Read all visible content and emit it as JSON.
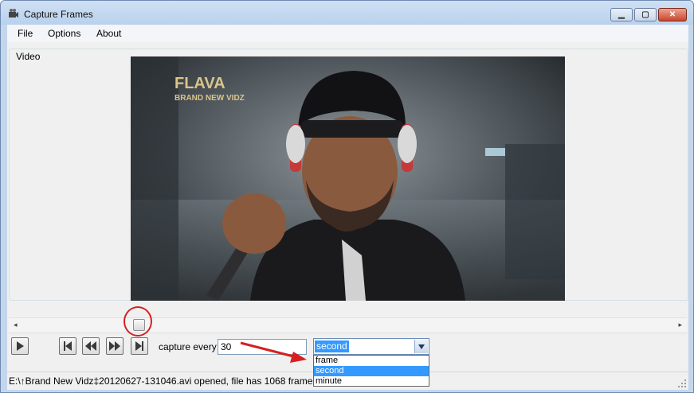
{
  "window": {
    "title": "Capture Frames",
    "min_label": "▁",
    "max_label": "▢",
    "close_label": "✕"
  },
  "menu": {
    "items": [
      "File",
      "Options",
      "About"
    ]
  },
  "video_group": {
    "label": "Video",
    "overlay_title": "FLAVA",
    "overlay_subtitle": "BRAND NEW VIDZ"
  },
  "playback": {
    "buttons": [
      "play-icon",
      "skip-to-start-icon",
      "rewind-icon",
      "fast-forward-icon",
      "skip-to-end-icon"
    ]
  },
  "capture": {
    "label": "capture every",
    "value": "30",
    "unit_selected": "second",
    "unit_options": [
      "frame",
      "second",
      "minute"
    ]
  },
  "status": {
    "text": "E:\\↑Brand New Vidz‡20120627-131046.avi opened, file has 1068 frames"
  },
  "colors": {
    "highlight": "#3399ff",
    "annotation": "#d62020"
  }
}
